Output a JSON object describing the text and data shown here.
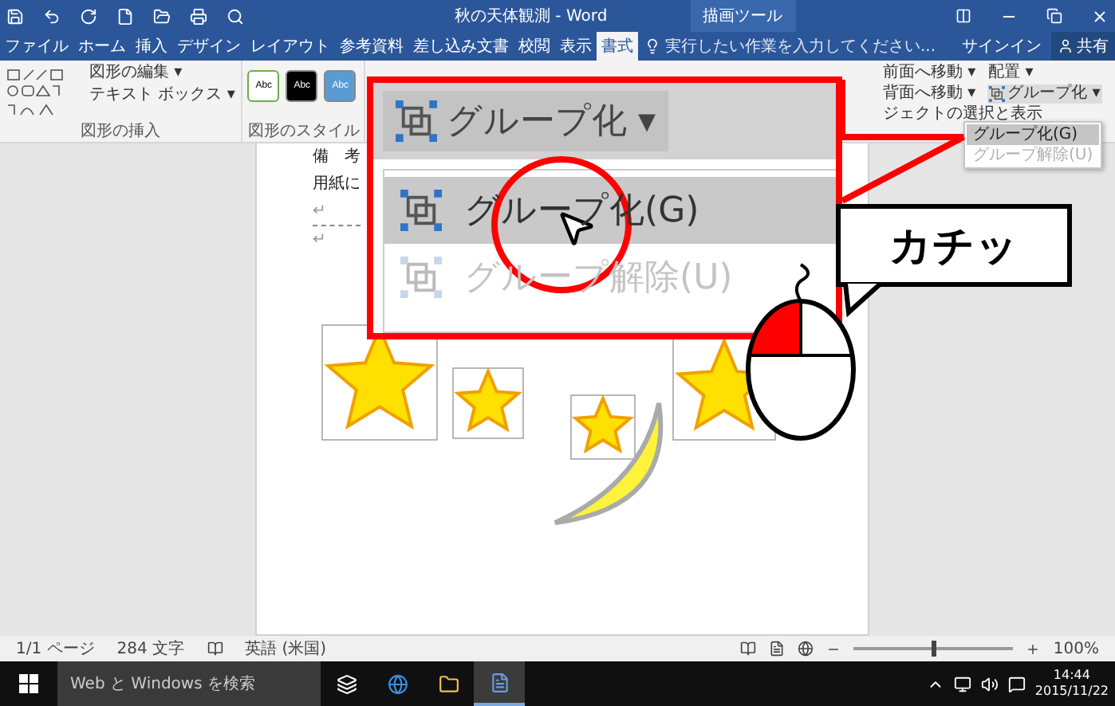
{
  "title_bar": {
    "title": "秋の天体観測 - Word",
    "context_tab": "描画ツール"
  },
  "tabs": [
    {
      "label": "ファイル",
      "selected": false
    },
    {
      "label": "ホーム",
      "selected": false
    },
    {
      "label": "挿入",
      "selected": false
    },
    {
      "label": "デザイン",
      "selected": false
    },
    {
      "label": "レイアウト",
      "selected": false
    },
    {
      "label": "参考資料",
      "selected": false
    },
    {
      "label": "差し込み文書",
      "selected": false
    },
    {
      "label": "校閲",
      "selected": false
    },
    {
      "label": "表示",
      "selected": false
    },
    {
      "label": "書式",
      "selected": true
    }
  ],
  "tell_me": {
    "placeholder": "実行したい作業を入力してください..."
  },
  "account": {
    "sign_in": "サインイン",
    "share": "共有"
  },
  "ribbon": {
    "insert_shapes": {
      "edit_shape": "図形の編集 ▾",
      "text_box": "テキスト ボックス ▾",
      "label": "図形の挿入"
    },
    "shape_styles": {
      "swatches": [
        {
          "label": "Abc",
          "color": "#ffffff"
        },
        {
          "label": "Abc",
          "color": "#000000"
        },
        {
          "label": "Abc",
          "color": "#5b9bd5"
        }
      ],
      "label": "図形のスタイル"
    },
    "arrange": {
      "bring_forward": "前面へ移動 ▾",
      "send_backward": "背面へ移動 ▾",
      "selection_pane": "ジェクトの選択と表示",
      "align": "配置 ▾",
      "group": "グループ化 ▾"
    },
    "group_menu": [
      {
        "label": "グループ化(G)",
        "disabled": false,
        "selected": true
      },
      {
        "label": "グループ解除(U)",
        "disabled": true,
        "selected": false
      }
    ]
  },
  "document": {
    "lines": [
      "備　考",
      "用紙に",
      "↵",
      "↵"
    ]
  },
  "callout": {
    "button": "グループ化 ▾",
    "items": [
      {
        "label": "グループ化(G)",
        "disabled": false,
        "selected": true
      },
      {
        "label": "グループ解除(U)",
        "disabled": true,
        "selected": false
      }
    ]
  },
  "speech_bubble": "カチッ",
  "status_bar": {
    "page": "1/1 ページ",
    "words": "284 文字",
    "language": "英語 (米国)",
    "zoom": "100%",
    "level": 0.5
  },
  "taskbar": {
    "search_placeholder": "Web と Windows を検索",
    "time": "14:44",
    "date": "2015/11/22"
  }
}
